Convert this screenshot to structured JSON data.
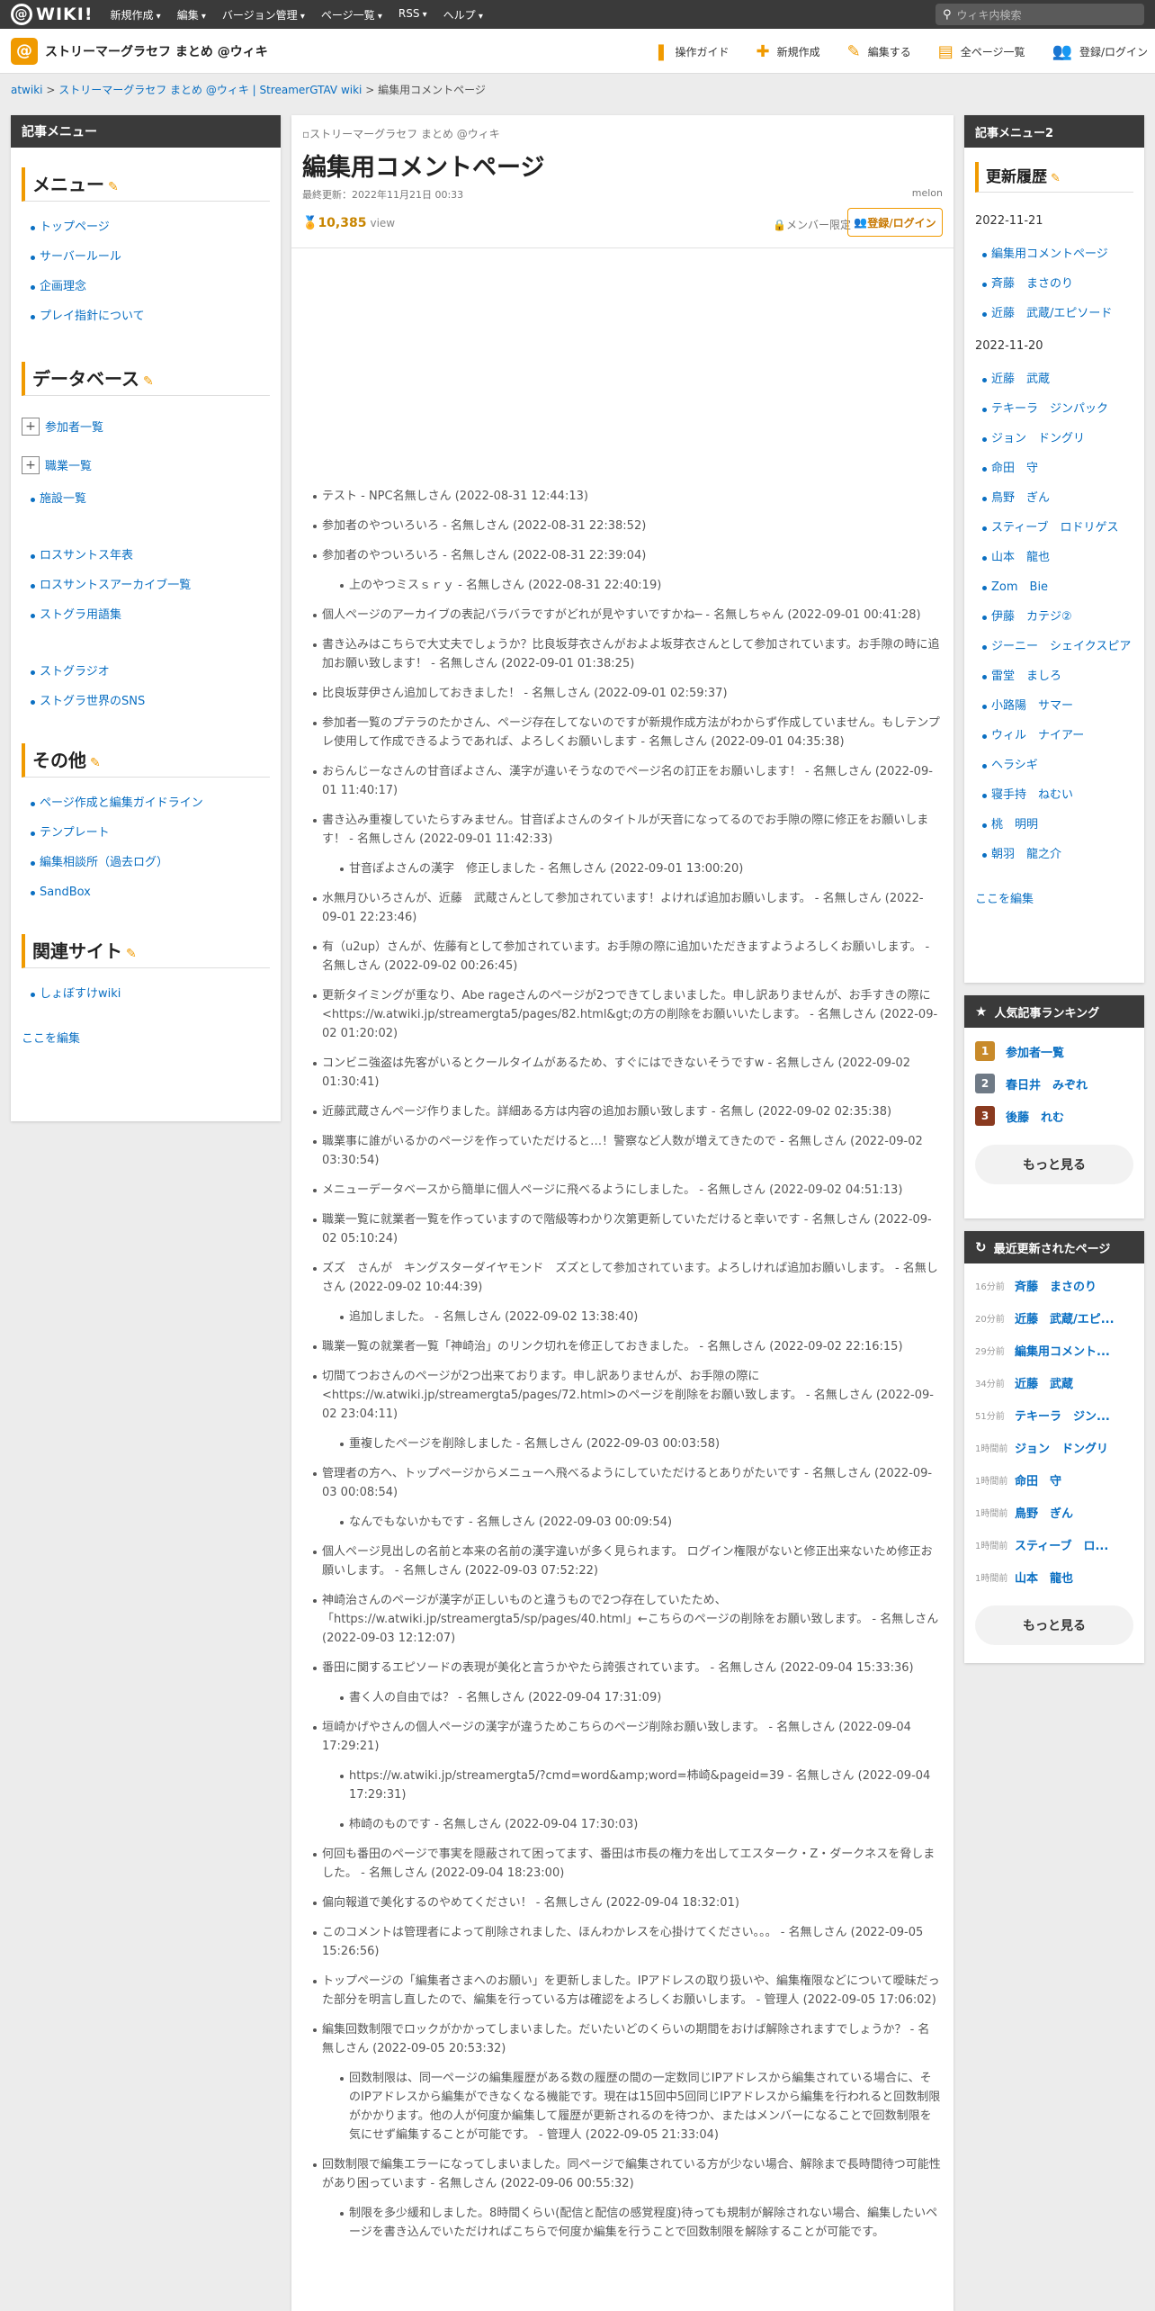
{
  "topbar": {
    "logo": "WIKI!",
    "nav": [
      "新規作成",
      "編集",
      "バージョン管理",
      "ページ一覧",
      "RSS",
      "ヘルプ"
    ],
    "search_placeholder": "ウィキ内検索"
  },
  "subbar": {
    "site_title": "ストリーマーグラセフ まとめ @ウィキ",
    "actions": [
      "操作ガイド",
      "新規作成",
      "編集する",
      "全ページ一覧",
      "登録/ログイン"
    ]
  },
  "breadcrumb": [
    "atwiki",
    "ストリーマーグラセフ まとめ @ウィキ | StreamerGTAV wiki",
    "編集用コメントページ"
  ],
  "left": {
    "head": "記事メニュー",
    "menu_title": "メニュー",
    "menu": [
      "トップページ",
      "サーバールール",
      "企画理念",
      "プレイ指針について"
    ],
    "db_title": "データベース",
    "db_plus": [
      "参加者一覧",
      "職業一覧"
    ],
    "db_items": [
      "施設一覧"
    ],
    "db_items2": [
      "ロスサントス年表",
      "ロスサントスアーカイブ一覧",
      "ストグラ用語集"
    ],
    "db_items3": [
      "ストグラジオ",
      "ストグラ世界のSNS"
    ],
    "other_title": "その他",
    "other": [
      "ページ作成と編集ガイドライン",
      "テンプレート",
      "編集相談所（過去ログ）",
      "SandBox"
    ],
    "related_title": "関連サイト",
    "related": [
      "しょぼすけwiki"
    ],
    "edit_here": "ここを編集"
  },
  "main": {
    "img_alt": "ストリーマーグラセフ まとめ @ウィキ",
    "title": "編集用コメントページ",
    "last_updated": "最終更新：2022年11月21日 00:33",
    "author": "melon",
    "views": "10,385",
    "views_label": "view",
    "member_only": "メンバー限定",
    "login": "登録/ログイン",
    "comments": [
      {
        "t": "テスト - NPC名無しさん (2022-08-31 12:44:13)"
      },
      {
        "t": "参加者のやついろいろ - 名無しさん (2022-08-31 22:38:52)"
      },
      {
        "t": "参加者のやついろいろ - 名無しさん (2022-08-31 22:39:04)",
        "sub": [
          "上のやつミスｓｒｙ - 名無しさん (2022-08-31 22:40:19)"
        ]
      },
      {
        "t": "個人ページのアーカイブの表記バラバラですがどれが見やすいですかね─ - 名無しちゃん (2022-09-01 00:41:28)"
      },
      {
        "t": "書き込みはこちらで大丈夫でしょうか？比良坂芽衣さんがおよよ坂芽衣さんとして参加されています。お手隙の時に追加お願い致します！ - 名無しさん (2022-09-01 01:38:25)"
      },
      {
        "t": "比良坂芽伊さん追加しておきました！ - 名無しさん (2022-09-01 02:59:37)"
      },
      {
        "t": "参加者一覧のプテラのたかさん、ページ存在してないのですが新規作成方法がわからず作成していません。もしテンプレ使用して作成できるようであれば、よろしくお願いします - 名無しさん (2022-09-01 04:35:38)"
      },
      {
        "t": "おらんじーなさんの甘音ぽよさん、漢字が違いそうなのでページ名の訂正をお願いします！ - 名無しさん (2022-09-01 11:40:17)"
      },
      {
        "t": "書き込み重複していたらすみません。甘音ぽよさんのタイトルが天音になってるのでお手隙の際に修正をお願いします！ - 名無しさん (2022-09-01 11:42:33)",
        "sub": [
          "甘音ぽよさんの漢字　修正しました - 名無しさん (2022-09-01 13:00:20)"
        ]
      },
      {
        "t": "水無月ひいろさんが、近藤　武蔵さんとして参加されています！よければ追加お願いします。 - 名無しさん (2022-09-01 22:23:46)"
      },
      {
        "t": "有（u2up）さんが、佐藤有として参加されています。お手隙の際に追加いただきますようよろしくお願いします。 - 名無しさん (2022-09-02 00:26:45)"
      },
      {
        "t": "更新タイミングが重なり、Abe rageさんのページが2つできてしまいました。申し訳ありませんが、お手すきの際に<https://w.atwiki.jp/streamergta5/pages/82.html&gt;の方の削除をお願いいたします。 - 名無しさん (2022-09-02 01:20:02)"
      },
      {
        "t": "コンビニ強盗は先客がいるとクールタイムがあるため、すぐにはできないそうですw - 名無しさん (2022-09-02 01:30:41)"
      },
      {
        "t": "近藤武蔵さんページ作りました。詳細ある方は内容の追加お願い致します - 名無し (2022-09-02 02:35:38)"
      },
      {
        "t": "職業事に誰がいるかのページを作っていただけると…！警察など人数が増えてきたので - 名無しさん (2022-09-02 03:30:54)"
      },
      {
        "t": "メニューデータベースから簡単に個人ページに飛べるようにしました。 - 名無しさん (2022-09-02 04:51:13)"
      },
      {
        "t": "職業一覧に就業者一覧を作っていますので階級等わかり次第更新していただけると幸いです - 名無しさん (2022-09-02 05:10:24)"
      },
      {
        "t": "ズズ　さんが　キングスターダイヤモンド　ズズとして参加されています。よろしければ追加お願いします。 - 名無しさん (2022-09-02 10:44:39)",
        "sub": [
          "追加しました。 - 名無しさん (2022-09-02 13:38:40)"
        ]
      },
      {
        "t": "職業一覧の就業者一覧「神崎治」のリンク切れを修正しておきました。 - 名無しさん (2022-09-02 22:16:15)"
      },
      {
        "t": "切間てつおさんのページが2つ出来ております。申し訳ありませんが、お手隙の際に<https://w.atwiki.jp/streamergta5/pages/72.html>のページを削除をお願い致します。 - 名無しさん (2022-09-02 23:04:11)",
        "sub": [
          "重複したページを削除しました - 名無しさん (2022-09-03 00:03:58)"
        ]
      },
      {
        "t": "管理者の方へ、トップページからメニューへ飛べるようにしていただけるとありがたいです - 名無しさん (2022-09-03 00:08:54)",
        "sub": [
          "なんでもないかもです - 名無しさん (2022-09-03 00:09:54)"
        ]
      },
      {
        "t": "個人ページ見出しの名前と本来の名前の漢字違いが多く見られます。 ログイン権限がないと修正出来ないため修正お願いします。 - 名無しさん (2022-09-03 07:52:22)"
      },
      {
        "t": "神崎治さんのページが漢字が正しいものと違うもので2つ存在していたため、「https://w.atwiki.jp/streamergta5/sp/pages/40.html」←こちらのページの削除をお願い致します。 - 名無しさん (2022-09-03 12:12:07)"
      },
      {
        "t": "番田に関するエピソードの表現が美化と言うかやたら誇張されています。 - 名無しさん (2022-09-04 15:33:36)",
        "sub": [
          "書く人の自由では？ - 名無しさん (2022-09-04 17:31:09)"
        ]
      },
      {
        "t": "垣崎かげやさんの個人ページの漢字が違うためこちらのページ削除お願い致します。 - 名無しさん (2022-09-04 17:29:21)",
        "sub": [
          "https://w.atwiki.jp/streamergta5/?cmd=word&amp;word=柿崎&pageid=39 - 名無しさん (2022-09-04 17:29:31)",
          "柿崎のものです - 名無しさん (2022-09-04 17:30:03)"
        ]
      },
      {
        "t": "何回も番田のページで事実を隠蔽されて困ってます、番田は市長の権力を出してエスターク・Z・ダークネスを脅しました。 - 名無しさん (2022-09-04 18:23:00)"
      },
      {
        "t": "偏向報道で美化するのやめてください！ - 名無しさん (2022-09-04 18:32:01)"
      },
      {
        "t": "このコメントは管理者によって削除されました、ほんわかレスを心掛けてください。。。 - 名無しさん (2022-09-05 15:26:56)"
      },
      {
        "t": "トップページの「編集者さまへのお願い」を更新しました。IPアドレスの取り扱いや、編集権限などについて曖昧だった部分を明言し直したので、編集を行っている方は確認をよろしくお願いします。 - 管理人 (2022-09-05 17:06:02)"
      },
      {
        "t": "編集回数制限でロックがかかってしまいました。だいたいどのくらいの期間をおけば解除されますでしょうか？ - 名無しさん (2022-09-05 20:53:32)",
        "sub": [
          "回数制限は、同一ページの編集履歴がある数の履歴の間の一定数同じIPアドレスから編集されている場合に、そのIPアドレスから編集ができなくなる機能です。現在は15回中5回同じIPアドレスから編集を行われると回数制限がかかります。他の人が何度か編集して履歴が更新されるのを待つか、またはメンバーになることで回数制限を気にせず編集することが可能です。 - 管理人 (2022-09-05 21:33:04)"
        ]
      },
      {
        "t": "回数制限で編集エラーになってしまいました。同ページで編集されている方が少ない場合、解除まで長時間待つ可能性があり困っています - 名無しさん (2022-09-06 00:55:32)",
        "sub": [
          "制限を多少緩和しました。8時間くらい(配信と配信の感覚程度)待っても規制が解除されない場合、編集したいページを書き込んでいただければこちらで何度か編集を行うことで回数制限を解除することが可能です。"
        ]
      }
    ]
  },
  "right": {
    "head": "記事メニュー2",
    "recent_title": "更新履歴",
    "dates": [
      "2022-11-21",
      "2022-11-20"
    ],
    "day1": [
      "編集用コメントページ",
      "斉藤　まさのり",
      "近藤　武蔵/エピソード"
    ],
    "day2": [
      "近藤　武蔵",
      "テキーラ　ジンパック",
      "ジョン　ドングリ",
      "命田　守",
      "鳥野　ぎん",
      "スティーブ　ロドリゲス",
      "山本　龍也",
      "Zom　Bie",
      "伊藤　カテジ②",
      "ジーニー　シェイクスピア",
      "雷堂　ましろ",
      "小路陽　サマー",
      "ウィル　ナイアー",
      "ヘラシギ",
      "寝手持　ねむい",
      "桃　明明",
      "朝羽　龍之介"
    ],
    "edit_here": "ここを編集",
    "rank_head": "人気記事ランキング",
    "ranking": [
      {
        "n": "1",
        "name": "参加者一覧",
        "color": "#c88a2a"
      },
      {
        "n": "2",
        "name": "春日井　みぞれ",
        "color": "#6f7a86"
      },
      {
        "n": "3",
        "name": "後藤　れむ",
        "color": "#8a3a1f"
      }
    ],
    "more": "もっと見る",
    "upd_head": "最近更新されたページ",
    "updates": [
      {
        "t": "16分前",
        "name": "斉藤　まさのり"
      },
      {
        "t": "20分前",
        "name": "近藤　武蔵/エピ..."
      },
      {
        "t": "29分前",
        "name": "編集用コメント..."
      },
      {
        "t": "34分前",
        "name": "近藤　武蔵"
      },
      {
        "t": "51分前",
        "name": "テキーラ　ジン..."
      },
      {
        "t": "1時間前",
        "name": "ジョン　ドングリ"
      },
      {
        "t": "1時間前",
        "name": "命田　守"
      },
      {
        "t": "1時間前",
        "name": "鳥野　ぎん"
      },
      {
        "t": "1時間前",
        "name": "スティーブ　ロ..."
      },
      {
        "t": "1時間前",
        "name": "山本　龍也"
      }
    ],
    "more2": "もっと見る"
  }
}
